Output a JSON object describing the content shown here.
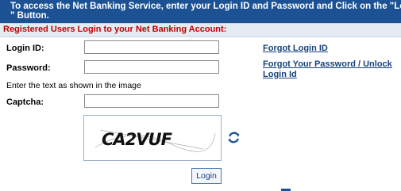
{
  "banner": {
    "line1": "To access the Net Banking Service, enter your Login ID and Password and Click on the \"Login",
    "line2": "\" Button."
  },
  "section_title": "Registered Users Login to your Net Banking Account:",
  "form": {
    "login_id_label": "Login ID:",
    "login_id_value": "",
    "password_label": "Password:",
    "password_value": "",
    "captcha_instruction": "Enter the text as shown in the image",
    "captcha_label": "Captcha:",
    "captcha_value": "",
    "captcha_image_text": "CA2VUF",
    "login_button": "Login"
  },
  "links": {
    "forgot_login": "Forgot Login ID",
    "forgot_password_line1": "Forgot Your Password / Unlock",
    "forgot_password_line2": "Login Id"
  },
  "icons": {
    "refresh": "refresh-icon"
  },
  "colors": {
    "banner_bg": "#1c5294",
    "section_title": "#c00000",
    "link": "#16427f"
  }
}
